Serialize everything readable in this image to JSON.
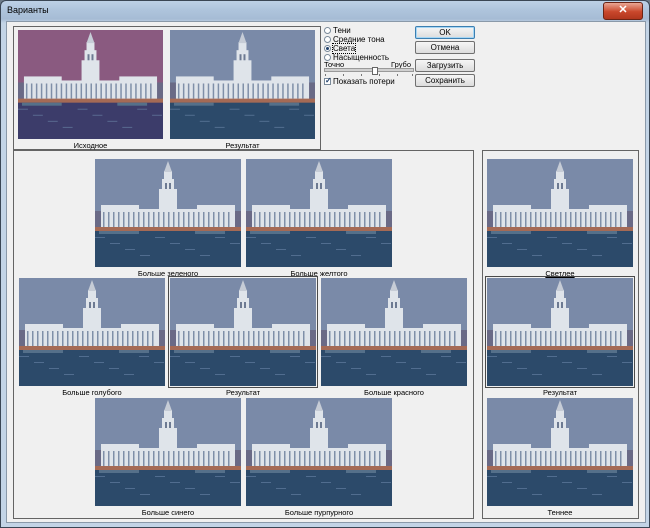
{
  "window": {
    "title": "Варианты",
    "close_glyph": "✕"
  },
  "top": {
    "original_label": "Исходное",
    "result_label": "Результат"
  },
  "tones": {
    "options": [
      {
        "label": "Тени",
        "selected": false
      },
      {
        "label": "Средние тона",
        "selected": false
      },
      {
        "label": "Света",
        "selected": true
      },
      {
        "label": "Насыщенность",
        "selected": false
      }
    ],
    "fine_label": "Точно",
    "coarse_label": "Грубо",
    "show_clipping_label": "Показать потери",
    "show_clipping_checked": true
  },
  "buttons": {
    "ok": "OK",
    "cancel": "Отмена",
    "load": "Загрузить",
    "save": "Сохранить"
  },
  "variations": {
    "more_green": "Больше зеленого",
    "more_yellow": "Больше желтого",
    "more_cyan": "Больше голубого",
    "current": "Результат",
    "more_red": "Больше красного",
    "more_blue": "Больше синего",
    "more_magenta": "Больше пурпурного"
  },
  "lightness": {
    "lighter": "Светлее",
    "current": "Результат",
    "darker": "Теннее"
  },
  "colors": {
    "sky_original": "#8a5a80",
    "water_original": "#3c3c6a",
    "sky_result": "#7a8aa8",
    "water_result": "#2c4a6a",
    "building": "#dfe4ea",
    "accent_selected": "#3c7fb1"
  }
}
